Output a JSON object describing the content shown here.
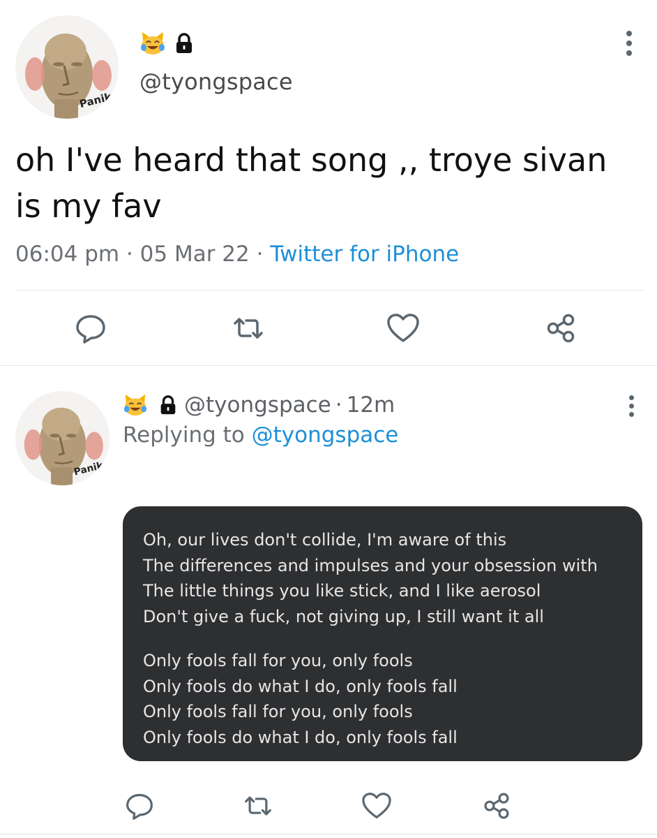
{
  "tweet": {
    "handle": "@tyongspace",
    "avatar_caption": "Panik",
    "badges": [
      "laughing-cat-emoji",
      "lock-icon"
    ],
    "text": "oh I've heard that song ,, troye sivan is my fav",
    "time": "06:04 pm",
    "date": "05 Mar 22",
    "separator": "·",
    "source": "Twitter for iPhone",
    "actions": [
      "reply-icon",
      "retweet-icon",
      "like-icon",
      "share-icon"
    ]
  },
  "reply": {
    "handle": "@tyongspace",
    "separator": "·",
    "age": "12m",
    "replying_prefix": "Replying to",
    "replying_to": "@tyongspace",
    "avatar_caption": "Panik",
    "lyrics": {
      "stanza1": [
        "Oh, our lives don't collide, I'm aware of this",
        "The differences and impulses and your obsession with",
        "The little things you like stick, and I like aerosol",
        "Don't give a fuck, not giving up, I still want it all"
      ],
      "stanza2": [
        "Only fools fall for you, only fools",
        "Only fools do what I do, only fools fall",
        "Only fools fall for you, only fools",
        "Only fools do what I do, only fools fall"
      ]
    }
  },
  "colors": {
    "link": "#1d8fd8",
    "meta": "#6a6f74",
    "card_bg": "#2e2f31",
    "icon": "#5b6770"
  }
}
